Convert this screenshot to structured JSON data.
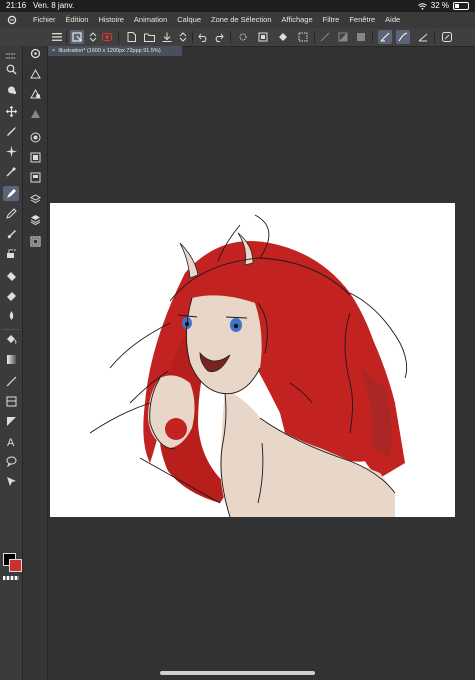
{
  "status_bar": {
    "time": "21:16",
    "date": "Ven. 8 janv.",
    "battery": "32 %"
  },
  "menu": {
    "items": [
      "Fichier",
      "Édition",
      "Histoire",
      "Animation",
      "Calque",
      "Zone de Sélection",
      "Affichage",
      "Filtre",
      "Fenêtre",
      "Aide"
    ]
  },
  "canvas": {
    "tab_title": "Illustration* (1600 x 1200px 72ppp 91.5%)",
    "close_glyph": "×"
  },
  "colors": {
    "main": "#000000",
    "sub": "#c8312f",
    "accent": "#5b6478"
  },
  "icons": {
    "left_tools": [
      "menu-icon",
      "zoom-icon",
      "hand-icon",
      "move-icon",
      "operation-icon",
      "auto-select-icon",
      "eyedropper-icon",
      "pen-icon",
      "pencil-icon",
      "brush-icon",
      "airbrush-icon",
      "eraser-icon",
      "blend-icon",
      "fill-icon",
      "gradient-icon",
      "figure-icon",
      "frame-icon",
      "ruler-icon",
      "text-icon",
      "balloon-icon",
      "correct-line-icon"
    ]
  }
}
